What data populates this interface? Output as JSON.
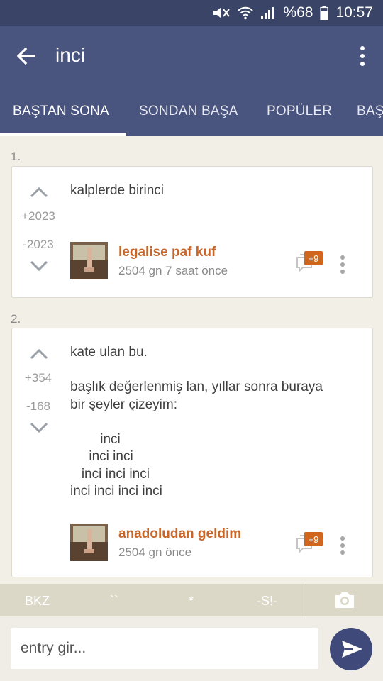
{
  "status_bar": {
    "battery": "%68",
    "time": "10:57",
    "icons": [
      "mute-icon",
      "wifi-icon",
      "signal-icon",
      "battery-icon"
    ]
  },
  "toolbar": {
    "title": "inci",
    "icons": [
      "back-arrow-icon",
      "more-vertical-icon"
    ]
  },
  "tabs": [
    {
      "label": "BAŞTAN SONA",
      "active": true
    },
    {
      "label": "SONDAN BAŞA",
      "active": false
    },
    {
      "label": "POPÜLER",
      "active": false
    },
    {
      "label": "BAŞ",
      "active": false
    }
  ],
  "entries": [
    {
      "number": "1.",
      "upvotes": "+2023",
      "downvotes": "-2023",
      "text": "kalplerde birinci",
      "author": "legalise paf kuf",
      "meta": "2504 gn 7 saat  önce",
      "comment_badge": "+9"
    },
    {
      "number": "2.",
      "upvotes": "+354",
      "downvotes": "-168",
      "text": "kate ulan bu.\n\nbaşlık değerlenmiş lan, yıllar sonra buraya\nbir şeyler çizeyim:\n\n        inci\n     inci inci\n   inci inci inci\ninci inci inci inci",
      "author": "anadoludan geldim",
      "meta": "2504 gn  önce",
      "comment_badge": "+9"
    }
  ],
  "shortcuts": [
    "BKZ",
    "``",
    "*",
    "-S!-"
  ],
  "composer": {
    "placeholder": "entry gir..."
  },
  "colors": {
    "toolbar": "#4a557f",
    "status_bar": "#3a4466",
    "author": "#c8662a",
    "badge": "#d0661e",
    "background": "#f1efe6"
  }
}
